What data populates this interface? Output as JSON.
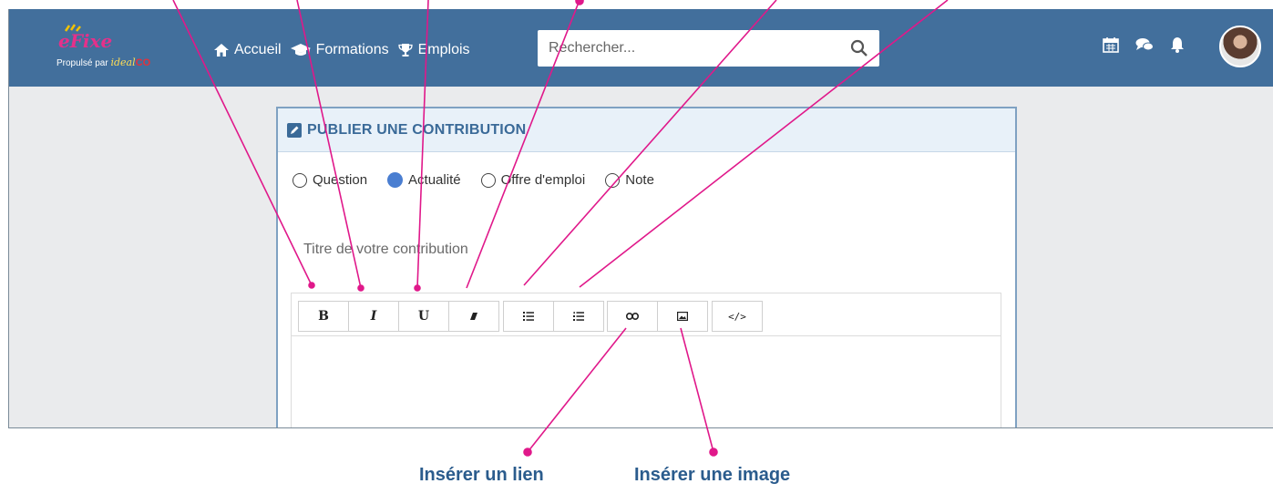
{
  "header": {
    "logo_text": "eFixe",
    "logo_subtitle": "Propulsé par",
    "logo_brand": "ideal",
    "logo_brand_co": "CO",
    "nav": [
      {
        "label": "Accueil",
        "icon": "home-icon"
      },
      {
        "label": "Formations",
        "icon": "graduation-cap-icon"
      },
      {
        "label": "Emplois",
        "icon": "trophy-icon"
      }
    ],
    "search": {
      "placeholder": "Rechercher..."
    },
    "icons": [
      "calendar-icon",
      "chat-icon",
      "bell-icon",
      "avatar"
    ]
  },
  "panel": {
    "title": "PUBLIER UNE CONTRIBUTION",
    "post_types": [
      {
        "label": "Question",
        "selected": false
      },
      {
        "label": "Actualité",
        "selected": true
      },
      {
        "label": "Offre d'emploi",
        "selected": false
      },
      {
        "label": "Note",
        "selected": false
      }
    ],
    "title_placeholder": "Titre de votre contribution",
    "toolbar": {
      "bold": "B",
      "italic": "I",
      "underline": "U",
      "code": "</>"
    }
  },
  "annotations": {
    "insert_link": "Insérer un lien",
    "insert_image": "Insérer une image"
  },
  "colors": {
    "header_bg": "#426f9c",
    "panel_title": "#3a6a98",
    "annotation_line": "#e0188a",
    "caption": "#2b5c8d"
  }
}
